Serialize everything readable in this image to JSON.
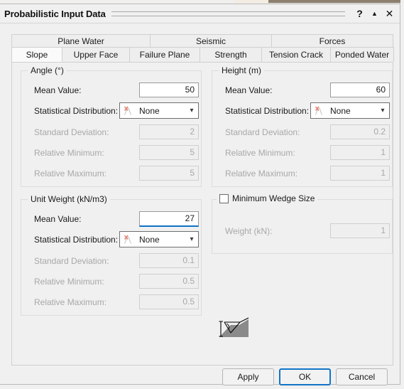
{
  "window": {
    "title": "Probabilistic Input Data",
    "help_label": "?",
    "rollup_label": "▲",
    "close_label": "✕"
  },
  "tabs": {
    "row1": [
      {
        "label": "Plane Water",
        "active": false
      },
      {
        "label": "Seismic",
        "active": false
      },
      {
        "label": "Forces",
        "active": false
      }
    ],
    "row2": [
      {
        "label": "Slope",
        "active": true
      },
      {
        "label": "Upper Face",
        "active": false
      },
      {
        "label": "Failure Plane",
        "active": false
      },
      {
        "label": "Strength",
        "active": false
      },
      {
        "label": "Tension Crack",
        "active": false
      },
      {
        "label": "Ponded Water",
        "active": false
      }
    ]
  },
  "groups": {
    "angle": {
      "title": "Angle (°)",
      "mean_label": "Mean Value:",
      "mean_value": "50",
      "dist_label": "Statistical Distribution:",
      "dist_value": "None",
      "std_label": "Standard Deviation:",
      "std_value": "2",
      "relmin_label": "Relative Minimum:",
      "relmin_value": "5",
      "relmax_label": "Relative Maximum:",
      "relmax_value": "5"
    },
    "height": {
      "title": "Height (m)",
      "mean_label": "Mean Value:",
      "mean_value": "60",
      "dist_label": "Statistical Distribution:",
      "dist_value": "None",
      "std_label": "Standard Deviation:",
      "std_value": "0.2",
      "relmin_label": "Relative Minimum:",
      "relmin_value": "1",
      "relmax_label": "Relative Maximum:",
      "relmax_value": "1"
    },
    "unit_weight": {
      "title": "Unit Weight (kN/m3)",
      "mean_label": "Mean Value:",
      "mean_value": "27",
      "dist_label": "Statistical Distribution:",
      "dist_value": "None",
      "std_label": "Standard Deviation:",
      "std_value": "0.1",
      "relmin_label": "Relative Minimum:",
      "relmin_value": "0.5",
      "relmax_label": "Relative Maximum:",
      "relmax_value": "0.5"
    },
    "min_wedge": {
      "title": "Minimum Wedge Size",
      "checked": false,
      "weight_label": "Weight (kN):",
      "weight_value": "1"
    }
  },
  "buttons": {
    "apply": "Apply",
    "ok": "OK",
    "cancel": "Cancel"
  },
  "colors": {
    "accent": "#0c72c4",
    "default_button_border": "#1275c8",
    "dialog_background": "#f0f0f0",
    "disabled_text": "#a8a8a8",
    "dist_icon": "#e8806c"
  }
}
